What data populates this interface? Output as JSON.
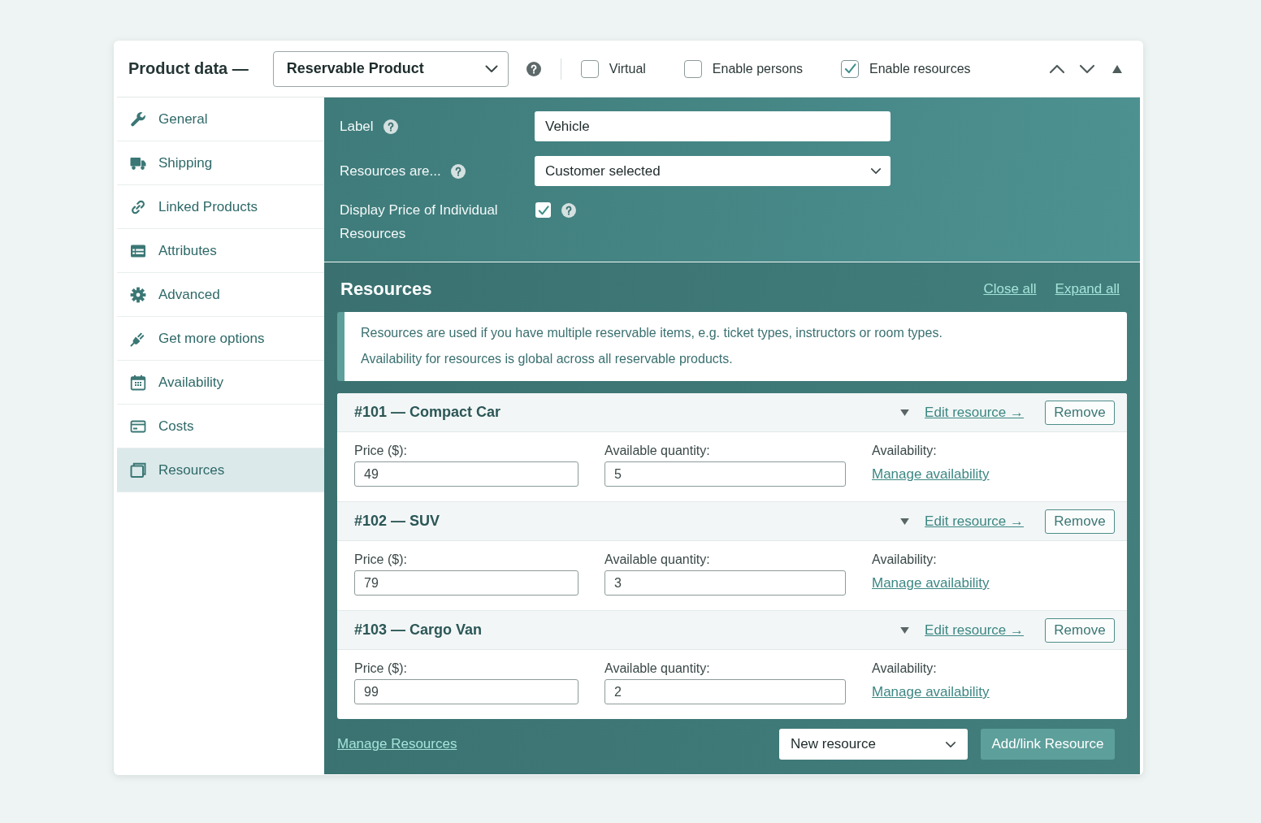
{
  "header": {
    "title": "Product data —",
    "product_type": {
      "value": "Reservable Product"
    },
    "options": [
      {
        "label": "Virtual",
        "checked": false
      },
      {
        "label": "Enable persons",
        "checked": false
      },
      {
        "label": "Enable resources",
        "checked": true
      }
    ]
  },
  "sidebar": {
    "items": [
      {
        "label": "General",
        "selected": false
      },
      {
        "label": "Shipping",
        "selected": false
      },
      {
        "label": "Linked Products",
        "selected": false
      },
      {
        "label": "Attributes",
        "selected": false
      },
      {
        "label": "Advanced",
        "selected": false
      },
      {
        "label": "Get more options",
        "selected": false
      },
      {
        "label": "Availability",
        "selected": false
      },
      {
        "label": "Costs",
        "selected": false
      },
      {
        "label": "Resources",
        "selected": true
      }
    ]
  },
  "settings": {
    "label_field": {
      "label": "Label",
      "value": "Vehicle"
    },
    "resources_are": {
      "label": "Resources are...",
      "value": "Customer selected"
    },
    "display_price": {
      "label": "Display Price of Individual Resources",
      "checked": true
    }
  },
  "resources": {
    "title": "Resources",
    "links": [
      "Close all",
      "Expand all"
    ],
    "notice": [
      "Resources are used if you have multiple reservable items, e.g. ticket types, instructors or room types.",
      "Availability for resources is global across all reservable products."
    ],
    "items": [
      {
        "title": "#101 — Compact Car",
        "edit_link": "Edit resource →",
        "remove_button": "Remove",
        "price": {
          "label": "Price ($):",
          "value": "49"
        },
        "quantity": {
          "label": "Available quantity:",
          "value": "5"
        },
        "availability": {
          "label": "Availability:",
          "link": "Manage availability"
        }
      },
      {
        "title": "#102 — SUV",
        "edit_link": "Edit resource →",
        "remove_button": "Remove",
        "price": {
          "label": "Price ($):",
          "value": "79"
        },
        "quantity": {
          "label": "Available quantity:",
          "value": "3"
        },
        "availability": {
          "label": "Availability:",
          "link": "Manage availability"
        }
      },
      {
        "title": "#103 — Cargo Van",
        "edit_link": "Edit resource →",
        "remove_button": "Remove",
        "price": {
          "label": "Price ($):",
          "value": "99"
        },
        "quantity": {
          "label": "Available quantity:",
          "value": "2"
        },
        "availability": {
          "label": "Availability:",
          "link": "Manage availability"
        }
      }
    ]
  },
  "footer": {
    "manage_link": "Manage Resources",
    "new_resource": {
      "value": "New resource"
    },
    "add_button": "Add/link Resource"
  }
}
